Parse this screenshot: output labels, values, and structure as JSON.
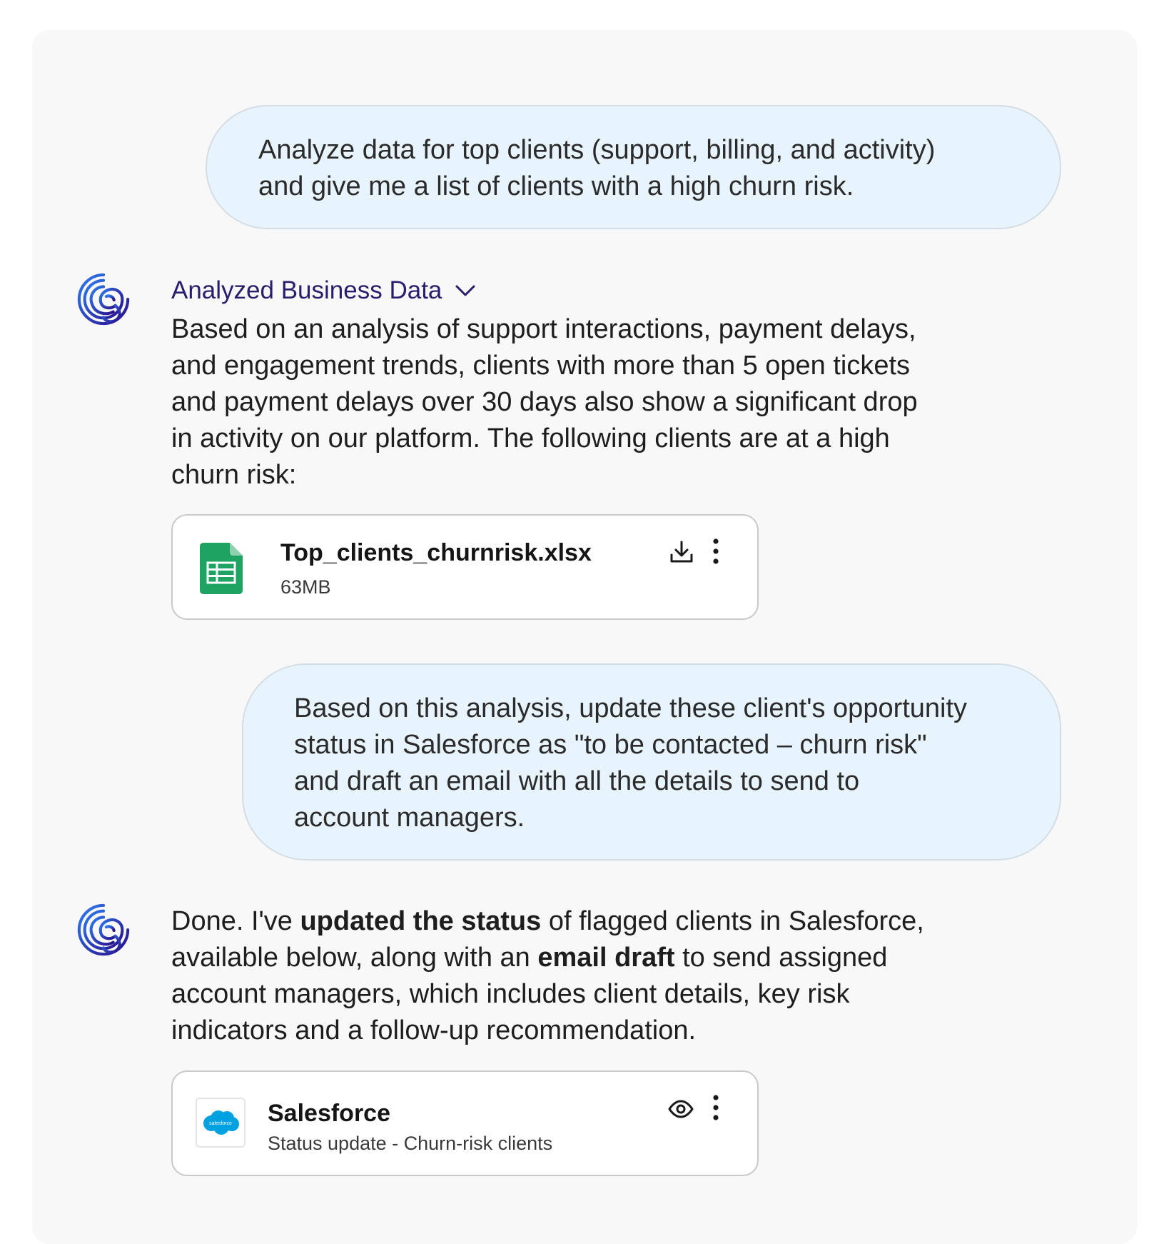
{
  "conversation": {
    "user_message_1": {
      "line_1": "Analyze data for top clients (support, billing, and activity)",
      "line_2": "and give me a list of clients with a high churn risk."
    },
    "assistant_message_1": {
      "thinking_label": "Analyzed Business Data",
      "lines": [
        "Based on an analysis of support interactions, payment delays,",
        "and engagement trends, clients with more than 5 open tickets",
        "and payment delays over 30 days also show a significant drop",
        "in activity on our platform. The following clients are at a high",
        "churn risk:"
      ],
      "attachment": {
        "file_name": "Top_clients_churnrisk.xlsx",
        "file_size": "63MB",
        "icon": "spreadsheet-icon"
      }
    },
    "user_message_2": {
      "lines": [
        "Based on this analysis, update these client's opportunity",
        "status in Salesforce as \"to be contacted – churn risk\"",
        "and draft an email with all the details to send to",
        "account managers."
      ]
    },
    "assistant_message_2": {
      "line_1": {
        "pre": "Done. I've ",
        "bold": "updated the status",
        "post": " of flagged clients in Salesforce,"
      },
      "line_2": {
        "pre": "available below, along with an ",
        "bold": "email draft",
        "post": " to send assigned"
      },
      "line_3": "account managers, which includes client details, key risk",
      "line_4": "indicators and a follow-up recommendation.",
      "attachment": {
        "title": "Salesforce",
        "subtitle": "Status update - Churn-risk clients",
        "logo_text": "salesforce",
        "icon": "salesforce-logo"
      }
    }
  },
  "colors": {
    "user_bubble": "#e8f4fd",
    "panel_background": "#f8f8f8",
    "thinking_label": "#2a1d6e",
    "avatar_gradient_start": "#2e7bf0",
    "avatar_gradient_end": "#2a0f8c",
    "sheets_green": "#1ea362",
    "salesforce_blue": "#00a1e0"
  }
}
